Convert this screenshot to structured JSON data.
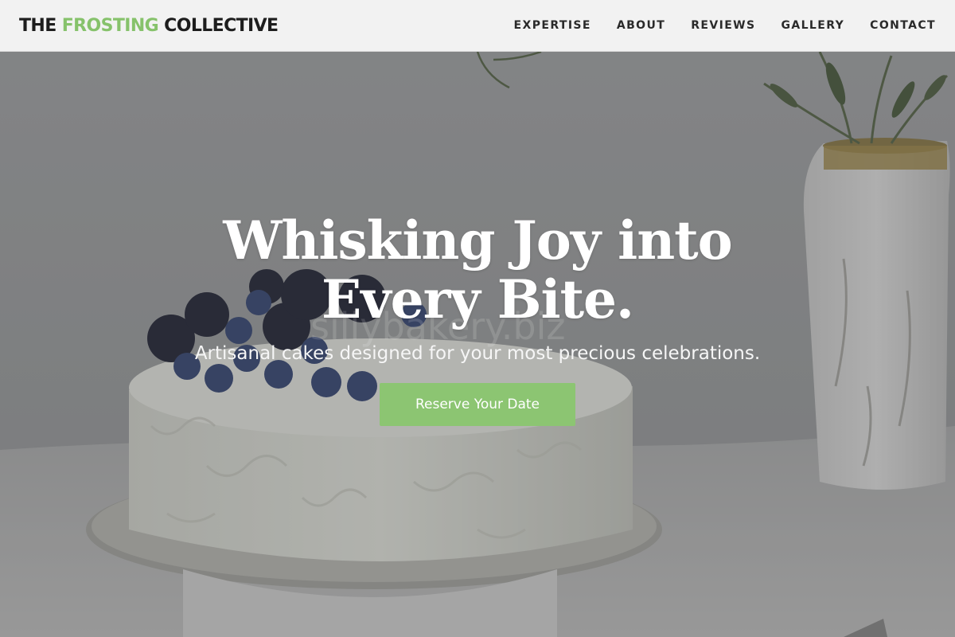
{
  "brand": {
    "part1": "THE ",
    "accent": "FROSTING",
    "part2": " COLLECTIVE"
  },
  "nav": {
    "items": [
      "EXPERTISE",
      "ABOUT",
      "REVIEWS",
      "GALLERY",
      "CONTACT"
    ]
  },
  "hero": {
    "headline": "Whisking Joy into Every Bite.",
    "subhead": "Artisanal cakes designed for your most precious celebrations.",
    "cta_label": "Reserve Your Date",
    "watermark": "sillybakery.biz"
  },
  "colors": {
    "accent": "#86c26b",
    "cta": "#8cc572",
    "nav_bg": "#f2f2f2"
  }
}
